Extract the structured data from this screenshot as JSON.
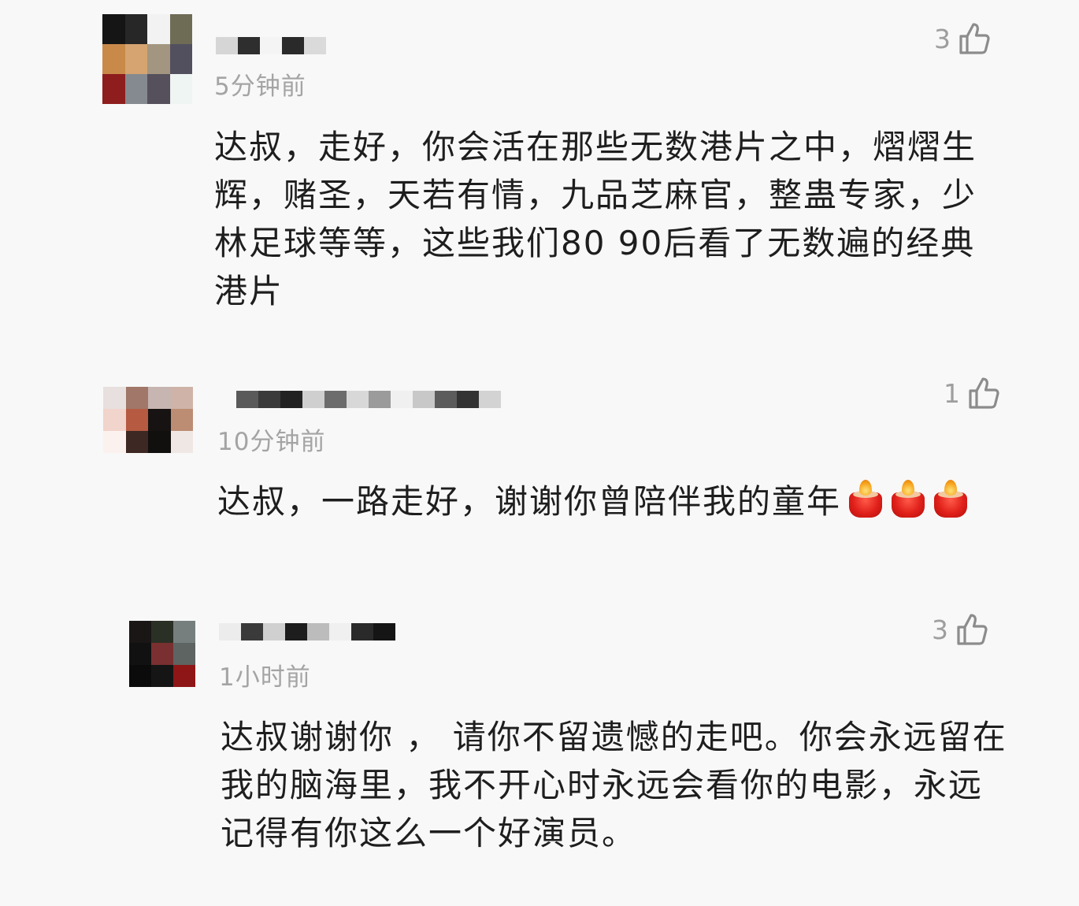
{
  "comments": [
    {
      "time": "5分钟前",
      "likes": "3",
      "body": "达叔，走好，你会活在那些无数港片之中，熠熠生辉，赌圣，天若有情，九品芝麻官，整蛊专家，少林足球等等，这些我们80 90后看了无数遍的经典港片",
      "avatar": [
        "#151515",
        "#272727",
        "#f2f2f2",
        "#6e6c55",
        "#c98949",
        "#d6a470",
        "#a39681",
        "#52505f",
        "#8e1d1d",
        "#858a90",
        "#56505c",
        "#eef5f2"
      ],
      "name_blocks": [
        "#d6d6d6",
        "#2e2e2e",
        "#f4f4f4",
        "#2a2a2a",
        "#dadada"
      ]
    },
    {
      "time": "10分钟前",
      "likes": "1",
      "body": "达叔，一路走好，谢谢你曾陪伴我的童年",
      "candles": [
        "candle-emoji",
        "candle-emoji",
        "candle-emoji"
      ],
      "avatar": [
        "#e7e0de",
        "#a07768",
        "#c6b5b1",
        "#cfb3a8",
        "#f1d4cc",
        "#b65a42",
        "#171313",
        "#bc8d73",
        "#fbf2ef",
        "#3e2823",
        "#120f0f",
        "#efe7e4"
      ],
      "name_blocks": [
        "#5a5a5a",
        "#3a3a3a",
        "#222222",
        "#cfcfcf",
        "#6c6c6c",
        "#d8d8d8",
        "#9b9b9b",
        "#f0f0f0",
        "#c8c8c8",
        "#5c5c5c",
        "#333333",
        "#d3d3d3"
      ]
    },
    {
      "time": "1小时前",
      "likes": "3",
      "body": "达叔谢谢你 ， 请你不留遗憾的走吧。你会永远留在我的脑海里，我不开心时永远会看你的电影，永远记得有你这么一个好演员。",
      "avatar": [
        "#1b1616",
        "#2a3025",
        "#767f7d",
        "#111111",
        "#7a3030",
        "#5d6462",
        "#0b0b0b",
        "#151515",
        "#8f1616"
      ],
      "name_blocks": [
        "#ececec",
        "#3a3a3a",
        "#d0d0d0",
        "#1d1d1d",
        "#bcbcbc",
        "#f0f0f0",
        "#2a2a2a",
        "#151515"
      ]
    }
  ]
}
